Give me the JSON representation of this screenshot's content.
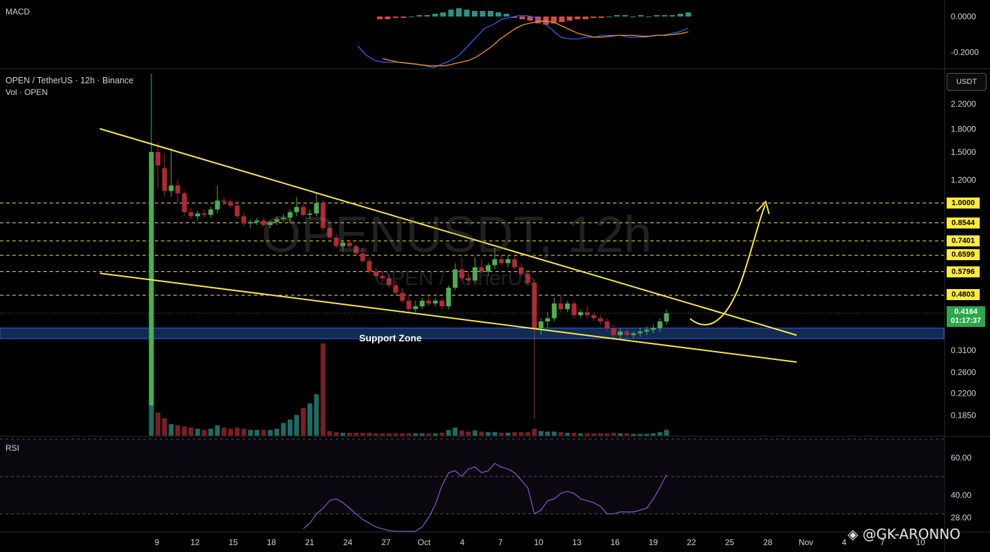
{
  "header": {
    "macd_label": "MACD",
    "rsi_label": "RSI",
    "title": "OPEN / TetherUS · 12h · Binance",
    "volume_label": "Vol · OPEN",
    "currency": "USDT"
  },
  "watermark": {
    "symbol": "OPENUSDT, 12h",
    "name": "OPEN / TetherUS"
  },
  "support_zone_label": "Support Zone",
  "last_price": {
    "value": "0.4164",
    "countdown": "01:17:37"
  },
  "credit": "◈ @GK-ARONNO",
  "colors": {
    "up": "#26a69a",
    "up_bright": "#4caf50",
    "down": "#b22833",
    "trendline": "#ffeb3b",
    "support_zone": "#1a3a6e",
    "rsi": "#7e57c2",
    "macd": "#2962ff",
    "signal": "#ff9800"
  },
  "chart_data": {
    "type": "candlestick",
    "symbol": "OPEN / TetherUS",
    "timeframe": "12h",
    "exchange": "Binance",
    "y_scale": "log",
    "price_ticks": [
      "2.2000",
      "1.8000",
      "1.5000",
      "1.2000",
      "1.0000",
      "0.8544",
      "0.7401",
      "0.6599",
      "0.5796",
      "0.4803",
      "0.4164",
      "0.3100",
      "0.2600",
      "0.2200",
      "0.1850"
    ],
    "x_ticks": [
      "9",
      "12",
      "15",
      "18",
      "21",
      "24",
      "27",
      "Oct",
      "4",
      "7",
      "10",
      "13",
      "16",
      "19",
      "22",
      "25",
      "28",
      "Nov",
      "4",
      "7",
      "10"
    ],
    "resistance_levels": [
      "1.0000",
      "0.8544",
      "0.7401",
      "0.6599",
      "0.5796",
      "0.4803"
    ],
    "support_zone": {
      "label": "Support Zone",
      "range": [
        0.34,
        0.37
      ]
    },
    "candles": [
      {
        "o": 0.2,
        "h": 2.8,
        "l": 0.2,
        "c": 1.5,
        "v": 100
      },
      {
        "o": 1.5,
        "h": 1.62,
        "l": 1.12,
        "c": 1.35,
        "v": 40
      },
      {
        "o": 1.32,
        "h": 1.48,
        "l": 1.05,
        "c": 1.1,
        "v": 30
      },
      {
        "o": 1.1,
        "h": 1.55,
        "l": 1.05,
        "c": 1.15,
        "v": 20
      },
      {
        "o": 1.15,
        "h": 1.2,
        "l": 1.0,
        "c": 1.08,
        "v": 18
      },
      {
        "o": 1.08,
        "h": 1.1,
        "l": 0.9,
        "c": 0.93,
        "v": 16
      },
      {
        "o": 0.93,
        "h": 0.96,
        "l": 0.88,
        "c": 0.9,
        "v": 14
      },
      {
        "o": 0.9,
        "h": 0.94,
        "l": 0.87,
        "c": 0.92,
        "v": 12
      },
      {
        "o": 0.92,
        "h": 0.95,
        "l": 0.89,
        "c": 0.91,
        "v": 10
      },
      {
        "o": 0.91,
        "h": 0.97,
        "l": 0.89,
        "c": 0.95,
        "v": 12
      },
      {
        "o": 0.95,
        "h": 1.15,
        "l": 0.92,
        "c": 1.02,
        "v": 18
      },
      {
        "o": 1.02,
        "h": 1.05,
        "l": 0.98,
        "c": 1.01,
        "v": 14
      },
      {
        "o": 1.01,
        "h": 1.03,
        "l": 0.96,
        "c": 0.98,
        "v": 12
      },
      {
        "o": 0.98,
        "h": 1.02,
        "l": 0.88,
        "c": 0.9,
        "v": 14
      },
      {
        "o": 0.9,
        "h": 0.93,
        "l": 0.83,
        "c": 0.85,
        "v": 12
      },
      {
        "o": 0.85,
        "h": 0.88,
        "l": 0.82,
        "c": 0.86,
        "v": 10
      },
      {
        "o": 0.86,
        "h": 0.89,
        "l": 0.84,
        "c": 0.87,
        "v": 10
      },
      {
        "o": 0.87,
        "h": 0.89,
        "l": 0.83,
        "c": 0.84,
        "v": 10
      },
      {
        "o": 0.84,
        "h": 0.87,
        "l": 0.82,
        "c": 0.86,
        "v": 10
      },
      {
        "o": 0.86,
        "h": 0.9,
        "l": 0.84,
        "c": 0.88,
        "v": 12
      },
      {
        "o": 0.88,
        "h": 0.92,
        "l": 0.86,
        "c": 0.89,
        "v": 22
      },
      {
        "o": 0.89,
        "h": 0.95,
        "l": 0.85,
        "c": 0.93,
        "v": 28
      },
      {
        "o": 0.93,
        "h": 1.05,
        "l": 0.9,
        "c": 0.97,
        "v": 36
      },
      {
        "o": 0.97,
        "h": 0.99,
        "l": 0.9,
        "c": 0.91,
        "v": 48
      },
      {
        "o": 0.91,
        "h": 0.95,
        "l": 0.88,
        "c": 0.92,
        "v": 56
      },
      {
        "o": 0.92,
        "h": 1.08,
        "l": 0.9,
        "c": 1.0,
        "v": 72
      },
      {
        "o": 1.0,
        "h": 1.02,
        "l": 0.8,
        "c": 0.82,
        "v": 160
      },
      {
        "o": 0.82,
        "h": 0.84,
        "l": 0.75,
        "c": 0.76,
        "v": 8
      },
      {
        "o": 0.76,
        "h": 0.78,
        "l": 0.7,
        "c": 0.71,
        "v": 6
      },
      {
        "o": 0.71,
        "h": 0.74,
        "l": 0.68,
        "c": 0.73,
        "v": 5
      },
      {
        "o": 0.73,
        "h": 0.75,
        "l": 0.7,
        "c": 0.71,
        "v": 5
      },
      {
        "o": 0.71,
        "h": 0.72,
        "l": 0.66,
        "c": 0.67,
        "v": 5
      },
      {
        "o": 0.67,
        "h": 0.7,
        "l": 0.62,
        "c": 0.63,
        "v": 5
      },
      {
        "o": 0.63,
        "h": 0.65,
        "l": 0.57,
        "c": 0.58,
        "v": 5
      },
      {
        "o": 0.58,
        "h": 0.6,
        "l": 0.55,
        "c": 0.56,
        "v": 4
      },
      {
        "o": 0.56,
        "h": 0.58,
        "l": 0.53,
        "c": 0.55,
        "v": 4
      },
      {
        "o": 0.55,
        "h": 0.57,
        "l": 0.51,
        "c": 0.52,
        "v": 4
      },
      {
        "o": 0.52,
        "h": 0.54,
        "l": 0.48,
        "c": 0.49,
        "v": 4
      },
      {
        "o": 0.49,
        "h": 0.51,
        "l": 0.45,
        "c": 0.46,
        "v": 4
      },
      {
        "o": 0.46,
        "h": 0.48,
        "l": 0.42,
        "c": 0.43,
        "v": 4
      },
      {
        "o": 0.43,
        "h": 0.46,
        "l": 0.42,
        "c": 0.44,
        "v": 4
      },
      {
        "o": 0.44,
        "h": 0.47,
        "l": 0.43,
        "c": 0.46,
        "v": 4
      },
      {
        "o": 0.46,
        "h": 0.48,
        "l": 0.44,
        "c": 0.45,
        "v": 4
      },
      {
        "o": 0.45,
        "h": 0.47,
        "l": 0.44,
        "c": 0.46,
        "v": 4
      },
      {
        "o": 0.46,
        "h": 0.47,
        "l": 0.43,
        "c": 0.44,
        "v": 5
      },
      {
        "o": 0.44,
        "h": 0.52,
        "l": 0.43,
        "c": 0.51,
        "v": 10
      },
      {
        "o": 0.51,
        "h": 0.62,
        "l": 0.5,
        "c": 0.59,
        "v": 14
      },
      {
        "o": 0.59,
        "h": 0.65,
        "l": 0.54,
        "c": 0.55,
        "v": 9
      },
      {
        "o": 0.55,
        "h": 0.58,
        "l": 0.52,
        "c": 0.54,
        "v": 7
      },
      {
        "o": 0.54,
        "h": 0.65,
        "l": 0.53,
        "c": 0.6,
        "v": 9
      },
      {
        "o": 0.6,
        "h": 0.64,
        "l": 0.57,
        "c": 0.58,
        "v": 7
      },
      {
        "o": 0.58,
        "h": 0.62,
        "l": 0.56,
        "c": 0.61,
        "v": 6
      },
      {
        "o": 0.61,
        "h": 0.7,
        "l": 0.59,
        "c": 0.64,
        "v": 6
      },
      {
        "o": 0.64,
        "h": 0.66,
        "l": 0.61,
        "c": 0.62,
        "v": 5
      },
      {
        "o": 0.62,
        "h": 0.66,
        "l": 0.6,
        "c": 0.64,
        "v": 5
      },
      {
        "o": 0.64,
        "h": 0.66,
        "l": 0.59,
        "c": 0.6,
        "v": 6
      },
      {
        "o": 0.6,
        "h": 0.62,
        "l": 0.56,
        "c": 0.57,
        "v": 6
      },
      {
        "o": 0.57,
        "h": 0.59,
        "l": 0.52,
        "c": 0.53,
        "v": 6
      },
      {
        "o": 0.53,
        "h": 0.54,
        "l": 0.18,
        "c": 0.37,
        "v": 12
      },
      {
        "o": 0.37,
        "h": 0.4,
        "l": 0.35,
        "c": 0.39,
        "v": 8
      },
      {
        "o": 0.39,
        "h": 0.42,
        "l": 0.37,
        "c": 0.4,
        "v": 7
      },
      {
        "o": 0.4,
        "h": 0.47,
        "l": 0.39,
        "c": 0.45,
        "v": 7
      },
      {
        "o": 0.45,
        "h": 0.48,
        "l": 0.42,
        "c": 0.43,
        "v": 6
      },
      {
        "o": 0.43,
        "h": 0.46,
        "l": 0.42,
        "c": 0.45,
        "v": 5
      },
      {
        "o": 0.45,
        "h": 0.46,
        "l": 0.4,
        "c": 0.41,
        "v": 5
      },
      {
        "o": 0.41,
        "h": 0.43,
        "l": 0.4,
        "c": 0.42,
        "v": 4
      },
      {
        "o": 0.42,
        "h": 0.44,
        "l": 0.4,
        "c": 0.41,
        "v": 4
      },
      {
        "o": 0.41,
        "h": 0.42,
        "l": 0.39,
        "c": 0.4,
        "v": 4
      },
      {
        "o": 0.4,
        "h": 0.41,
        "l": 0.38,
        "c": 0.39,
        "v": 4
      },
      {
        "o": 0.39,
        "h": 0.4,
        "l": 0.36,
        "c": 0.37,
        "v": 4
      },
      {
        "o": 0.37,
        "h": 0.38,
        "l": 0.34,
        "c": 0.35,
        "v": 5
      },
      {
        "o": 0.35,
        "h": 0.37,
        "l": 0.34,
        "c": 0.36,
        "v": 4
      },
      {
        "o": 0.36,
        "h": 0.37,
        "l": 0.34,
        "c": 0.35,
        "v": 4
      },
      {
        "o": 0.35,
        "h": 0.36,
        "l": 0.34,
        "c": 0.355,
        "v": 3
      },
      {
        "o": 0.355,
        "h": 0.37,
        "l": 0.345,
        "c": 0.36,
        "v": 3
      },
      {
        "o": 0.36,
        "h": 0.375,
        "l": 0.35,
        "c": 0.365,
        "v": 3
      },
      {
        "o": 0.365,
        "h": 0.38,
        "l": 0.355,
        "c": 0.37,
        "v": 4
      },
      {
        "o": 0.37,
        "h": 0.4,
        "l": 0.36,
        "c": 0.39,
        "v": 6
      },
      {
        "o": 0.39,
        "h": 0.43,
        "l": 0.38,
        "c": 0.4164,
        "v": 10
      }
    ],
    "rsi": {
      "ticks": [
        "60.00",
        "40.00",
        "28.00"
      ],
      "values": [
        null,
        null,
        null,
        null,
        null,
        null,
        null,
        null,
        null,
        null,
        null,
        null,
        null,
        null,
        null,
        null,
        null,
        null,
        null,
        null,
        null,
        null,
        null,
        22,
        25,
        30,
        33,
        37,
        38,
        36,
        33,
        30,
        27,
        25,
        23,
        22,
        21,
        19,
        18,
        17,
        20,
        23,
        28,
        35,
        45,
        52,
        53,
        50,
        54,
        55,
        52,
        53,
        57,
        55,
        54,
        52,
        48,
        44,
        30,
        32,
        37,
        38,
        41,
        42,
        41,
        38,
        37,
        36,
        34,
        30,
        30,
        31,
        31,
        31,
        32,
        33,
        38,
        44,
        51
      ]
    },
    "macd": {
      "ticks": [
        "0.0000",
        "-0.2000"
      ],
      "macd_line": [
        -0.15,
        -0.2,
        -0.23,
        -0.24,
        -0.24,
        -0.24,
        -0.245,
        -0.25,
        -0.26,
        -0.27,
        -0.25,
        -0.23,
        -0.2,
        -0.15,
        -0.1,
        -0.05,
        -0.03,
        0.0,
        0.01,
        0.02,
        0.02,
        0.01,
        -0.02,
        -0.06,
        -0.1,
        -0.11,
        -0.11,
        -0.1,
        -0.1,
        -0.09,
        -0.09,
        -0.09,
        -0.1,
        -0.1,
        -0.1,
        -0.09,
        -0.09,
        -0.08,
        -0.07,
        -0.05
      ],
      "signal_line": [
        -0.22,
        -0.23,
        -0.24,
        -0.245,
        -0.25,
        -0.255,
        -0.26,
        -0.26,
        -0.26,
        -0.25,
        -0.24,
        -0.23,
        -0.21,
        -0.18,
        -0.15,
        -0.11,
        -0.08,
        -0.05,
        -0.03,
        -0.02,
        -0.01,
        -0.01,
        -0.02,
        -0.04,
        -0.06,
        -0.08,
        -0.09,
        -0.1,
        -0.1,
        -0.095,
        -0.09,
        -0.09,
        -0.09,
        -0.095,
        -0.095,
        -0.09,
        -0.09,
        -0.085,
        -0.08,
        -0.07
      ],
      "histogram": [
        -0.02,
        -0.02,
        -0.01,
        -0.01,
        0.0,
        0.01,
        0.01,
        0.02,
        0.03,
        0.05,
        0.06,
        0.05,
        0.04,
        0.04,
        0.04,
        0.03,
        0.02,
        -0.01,
        -0.02,
        -0.03,
        -0.05,
        -0.06,
        -0.05,
        -0.04,
        -0.03,
        -0.02,
        -0.02,
        -0.01,
        -0.01,
        0.0,
        0.01,
        0.01,
        0.0,
        0.01,
        0.0,
        0.01,
        0.01,
        0.01,
        0.02,
        0.03
      ]
    }
  }
}
